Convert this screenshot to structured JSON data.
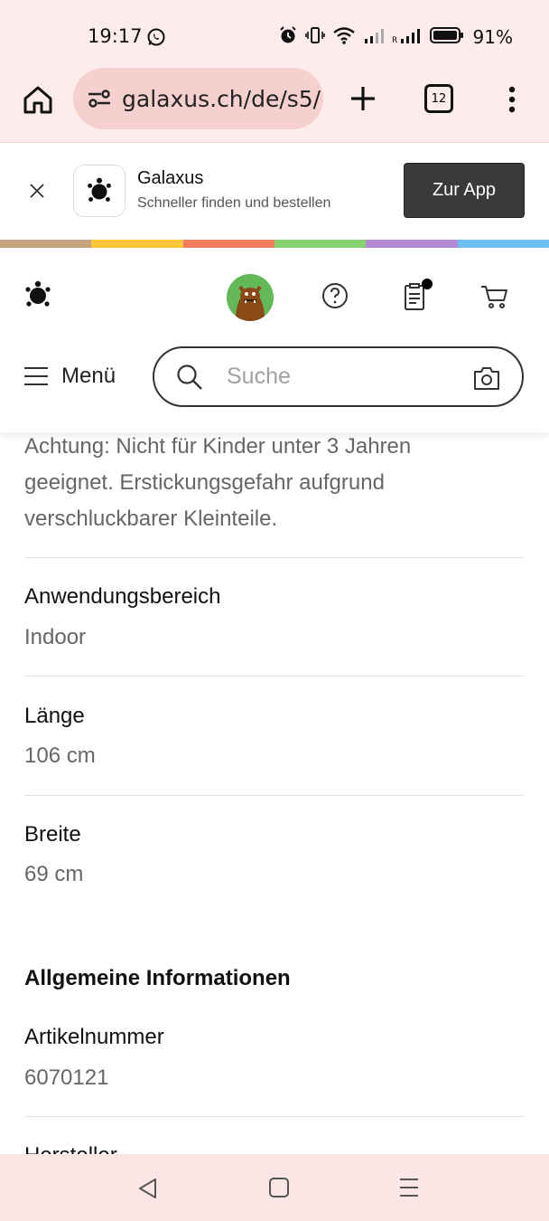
{
  "status_bar": {
    "time": "19:17",
    "battery_percent": "91%",
    "icons": [
      "whatsapp-icon",
      "alarm-icon",
      "vibrate-icon",
      "wifi-icon",
      "signal-icon",
      "signal-roaming-icon",
      "battery-icon"
    ]
  },
  "browser": {
    "url": "galaxus.ch/de/s5/",
    "tab_count": "12"
  },
  "app_banner": {
    "app_name": "Galaxus",
    "tagline": "Schneller finden und bestellen",
    "cta_label": "Zur App"
  },
  "brand_strip_colors": [
    "#c8a27c",
    "#fcc73a",
    "#f77d5f",
    "#86d06d",
    "#b489d3",
    "#6fc0f3"
  ],
  "header": {
    "menu_label": "Menü",
    "search_placeholder": "Suche"
  },
  "content": {
    "warning": "Achtung: Nicht für Kinder unter 3 Jahren geeignet. Erstickungsgefahr aufgrund verschluckbarer Kleinteile.",
    "specs": [
      {
        "label": "Anwendungsbereich",
        "value": "Indoor"
      },
      {
        "label": "Länge",
        "value": "106 cm"
      },
      {
        "label": "Breite",
        "value": "69 cm"
      }
    ],
    "general_section": {
      "title": "Allgemeine Informationen",
      "items": [
        {
          "label": "Artikelnummer",
          "value": "6070121"
        },
        {
          "label": "Hersteller",
          "value": ""
        }
      ]
    }
  }
}
